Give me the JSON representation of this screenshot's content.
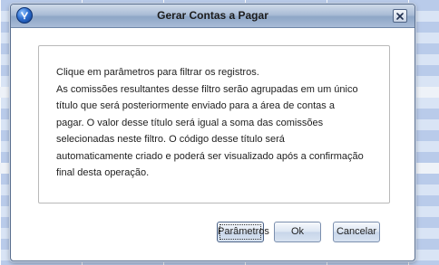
{
  "dialog": {
    "title": "Gerar Contas a Pagar",
    "message_lines": [
      "Clique em parâmetros para filtrar os registros.",
      "As comissões resultantes desse filtro serão agrupadas em um único",
      "título que será posteriormente enviado para a área de contas a",
      "pagar. O valor desse título será igual a soma das comissões",
      "selecionadas neste filtro. O código desse título será",
      "automaticamente criado e poderá ser visualizado após a confirmação",
      "final desta operação."
    ],
    "buttons": {
      "parameters": "Parâmetros",
      "ok": "Ok",
      "cancel": "Cancelar"
    },
    "icons": {
      "app": "app-logo-icon",
      "close": "close-icon"
    }
  },
  "colors": {
    "titlebar": "#a9bcd7",
    "background_grid": "#c6d6ef",
    "panel_border": "#b9b9b9"
  }
}
